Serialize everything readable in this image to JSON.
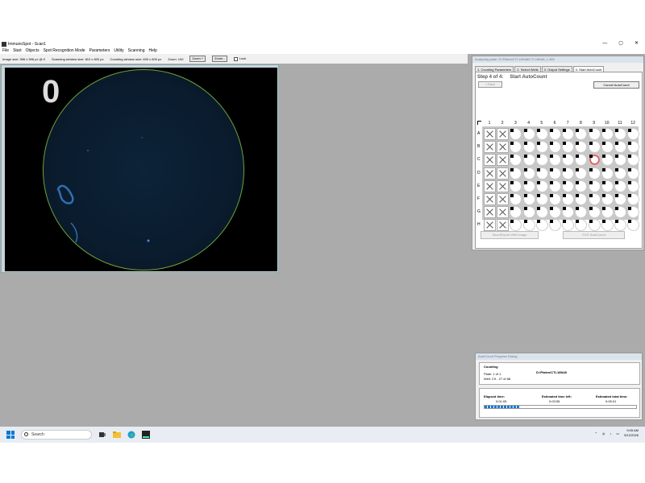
{
  "app": {
    "title": "ImmunoSpot - Scan1",
    "win_min": "—",
    "win_max": "▢",
    "win_close": "✕"
  },
  "menu": [
    "File",
    "Start",
    "Objects",
    "Spot Recognition Mode",
    "Parameters",
    "Utility",
    "Scanning",
    "Help"
  ],
  "infobar": {
    "image_size": "Image size: 596 x 596 px @ 0",
    "scanning_window": "Scanning window size: 810 x 600 px",
    "counting_window": "Counting window size: 600 x 600 px",
    "zoom_label": "Zoom: 100",
    "zoom_plus": "Zoom +",
    "zoom_minus": "Zoom -",
    "lock": "Lock"
  },
  "image": {
    "count": "0"
  },
  "panel": {
    "title": "Analyzing plate:  D:\\Plates\\CTL18N48\\CTL18N48_1.465",
    "tabs": [
      "1. Counting Parameters",
      "2. Select Wells",
      "3. Output Settings",
      "4. Start AutoCount"
    ],
    "step": "Step 4 of 4:",
    "step_title": "Start AutoCount",
    "back": "< Back",
    "cancel": "Cancel AutoCount",
    "columns": [
      "1",
      "2",
      "3",
      "4",
      "5",
      "6",
      "7",
      "8",
      "9",
      "10",
      "11",
      "12"
    ],
    "rows": [
      "A",
      "B",
      "C",
      "D",
      "E",
      "F",
      "G",
      "H"
    ],
    "save_btn": "Save/Export Well Image",
    "exit_btn": "EXIT AutoCount"
  },
  "progress": {
    "title": "AutoCount Progress Dialog",
    "status": "Counting",
    "plate": "Plate: 1 of 1",
    "path": "D:\\Plates\\CTL18N48",
    "well": "Well:  C9 - 27 of 88",
    "elapsed_label": "Elapsed time:",
    "elapsed": "0:01:05",
    "left_label": "Estimated time left:",
    "left": "0:03:55",
    "total_label": "Estimated total time:",
    "total": "0:05:01",
    "fraction": 0.23
  },
  "taskbar": {
    "search": "Search",
    "time": "9:05 AM",
    "date": "5/12/2026"
  }
}
